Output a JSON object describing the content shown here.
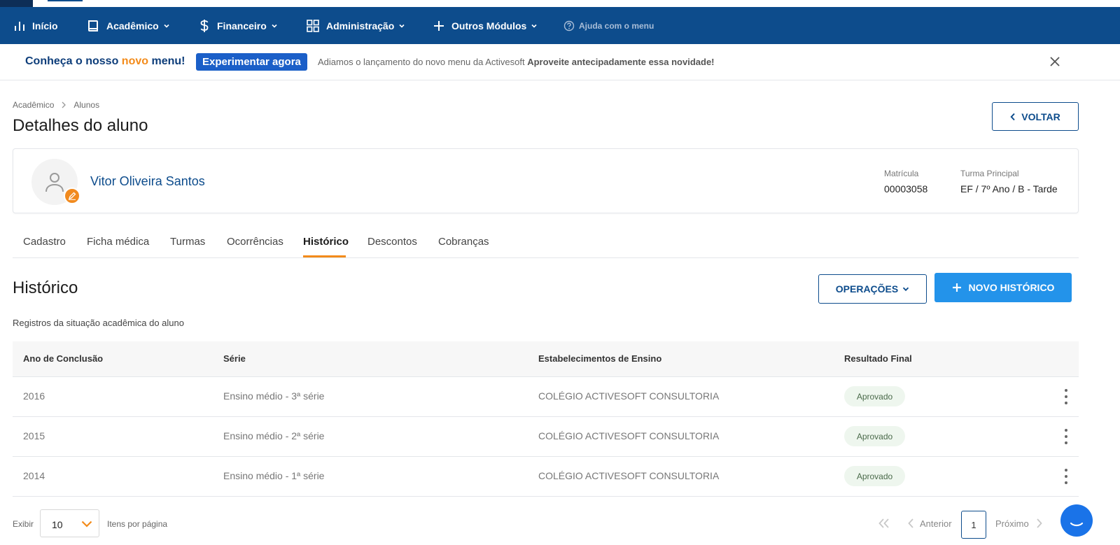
{
  "nav": {
    "items": [
      {
        "label": "Início",
        "icon": "bar-chart-icon"
      },
      {
        "label": "Acadêmico",
        "icon": "book-icon"
      },
      {
        "label": "Financeiro",
        "icon": "dollar-icon"
      },
      {
        "label": "Administração",
        "icon": "grid-icon"
      },
      {
        "label": "Outros Módulos",
        "icon": "plus-icon"
      }
    ],
    "help_label": "Ajuda com o menu"
  },
  "banner": {
    "title_prefix": "Conheça o nosso ",
    "title_highlight": "novo",
    "title_suffix": " menu!",
    "button_label": "Experimentar agora",
    "text_normal": "Adiamos o lançamento do novo menu da Activesoft ",
    "text_bold": "Aproveite antecipadamente essa novidade!"
  },
  "breadcrumb": [
    "Acadêmico",
    "Alunos"
  ],
  "page_title": "Detalhes do aluno",
  "back_label": "VOLTAR",
  "student": {
    "name": "Vitor Oliveira Santos",
    "matricula_label": "Matrícula",
    "matricula": "00003058",
    "turma_label": "Turma Principal",
    "turma": "EF / 7º Ano / B - Tarde"
  },
  "tabs": [
    "Cadastro",
    "Ficha médica",
    "Turmas",
    "Ocorrências",
    "Histórico",
    "Descontos",
    "Cobranças"
  ],
  "active_tab": "Histórico",
  "section": {
    "title": "Histórico",
    "subtitle": "Registros da situação acadêmica do aluno",
    "ops_label": "OPERAÇÕES",
    "new_label": "NOVO HISTÓRICO"
  },
  "table": {
    "headers": [
      "Ano de Conclusão",
      "Série",
      "Estabelecimentos de Ensino",
      "Resultado Final"
    ],
    "rows": [
      {
        "ano": "2016",
        "serie": "Ensino médio - 3ª série",
        "estab": "COLÉGIO ACTIVESOFT CONSULTORIA",
        "resultado": "Aprovado"
      },
      {
        "ano": "2015",
        "serie": "Ensino médio - 2ª série",
        "estab": "COLÉGIO ACTIVESOFT CONSULTORIA",
        "resultado": "Aprovado"
      },
      {
        "ano": "2014",
        "serie": "Ensino médio - 1ª série",
        "estab": "COLÉGIO ACTIVESOFT CONSULTORIA",
        "resultado": "Aprovado"
      }
    ]
  },
  "pagination": {
    "show_label": "Exibir",
    "page_size": "10",
    "per_page_label": "Itens por página",
    "prev_label": "Anterior",
    "current_page": "1",
    "next_label": "Próximo"
  },
  "colors": {
    "primary": "#0d4c8c",
    "accent": "#f38b1a",
    "button_blue": "#2393ea"
  }
}
